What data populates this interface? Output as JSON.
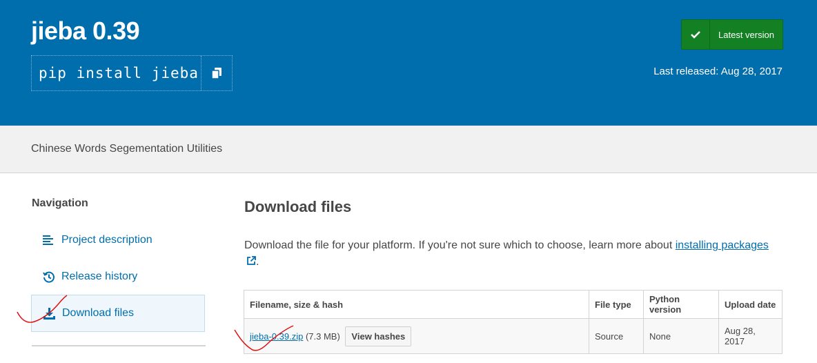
{
  "header": {
    "title": "jieba 0.39",
    "pip_command": "pip install jieba",
    "latest_label": "Latest version",
    "released": "Last released: Aug 28, 2017"
  },
  "summary": "Chinese Words Segementation Utilities",
  "navigation": {
    "heading": "Navigation",
    "items": [
      {
        "label": "Project description",
        "icon": "align-left-icon"
      },
      {
        "label": "Release history",
        "icon": "history-icon"
      },
      {
        "label": "Download files",
        "icon": "download-icon",
        "active": true
      }
    ]
  },
  "main": {
    "title": "Download files",
    "intro_text": "Download the file for your platform. If you're not sure which to choose, learn more about ",
    "intro_link": "installing packages",
    "intro_end": ".",
    "table": {
      "headers": [
        "Filename, size & hash",
        "File type",
        "Python version",
        "Upload date"
      ],
      "rows": [
        {
          "filename": "jieba-0.39.zip",
          "size": "(7.3 MB)",
          "hash_button": "View hashes",
          "file_type": "Source",
          "python_version": "None",
          "upload_date": "Aug 28, 2017"
        }
      ]
    }
  },
  "colors": {
    "banner": "#006dad",
    "latest_button": "#148024",
    "link": "#006dad",
    "annotation": "#e01010"
  }
}
